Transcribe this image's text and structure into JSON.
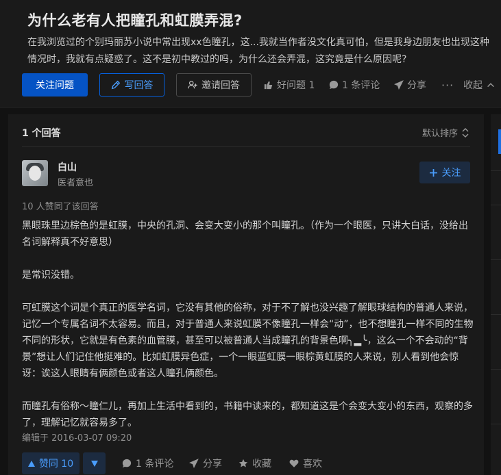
{
  "question": {
    "title": "为什么老有人把瞳孔和虹膜弄混?",
    "description": "在我浏览过的个别玛丽苏小说中常出现xx色瞳孔，这...我就当作者没文化真可怕，但是我身边朋友也出现这种情况时，我就有点疑惑了。这不是初中教过的吗，为什么还会弄混，这究竟是什么原因呢?",
    "follow_label": "关注问题",
    "write_label": "写回答",
    "invite_label": "邀请回答",
    "good_question_label": "好问题 1",
    "comments_label": "1 条评论",
    "share_label": "分享",
    "more_label": "···",
    "collapse_label": "收起"
  },
  "answers": {
    "count_label": "1 个回答",
    "sort_label": "默认排序"
  },
  "answer": {
    "author_name": "白山",
    "author_badge": "医者意也",
    "follow_label": "关注",
    "voters_text": "10 人赞同了该回答",
    "paragraphs": [
      "黑眼珠里边棕色的是虹膜，中央的孔洞、会变大变小的那个叫瞳孔。（作为一个眼医，只讲大白话，没给出名词解释真不好意思）",
      "是常识没错。",
      "可虹膜这个词是个真正的医学名词，它没有其他的俗称，对于不了解也没兴趣了解眼球结构的普通人来说，记忆一个专属名词不太容易。而且，对于普通人来说虹膜不像瞳孔一样会“动”，也不想瞳孔一样不同的生物不同的形状，它就是有色素的血管膜，甚至可以被普通人当成瞳孔的背景色啊╮▂╰，这么一个不会动的“背景”想让人们记住他挺难的。比如虹膜异色症，一个一眼蓝虹膜一眼棕黄虹膜的人来说，别人看到他会惊讶：诶这人眼睛有俩颜色或者这人瞳孔俩颜色。",
      "而瞳孔有俗称～瞳仁儿，再加上生活中看到的，书籍中读来的，都知道这是个会变大变小的东西，观察的多了，理解记忆就容易多了。"
    ],
    "edited_text": "编辑于 2016-03-07 09:20",
    "vote_up_label": "赞同 10",
    "comments_label": "1 条评论",
    "share_label": "分享",
    "collect_label": "收藏",
    "like_label": "喜欢"
  },
  "colors": {
    "primary": "#0553c4",
    "link": "#4a9dfc",
    "background": "#121212",
    "card": "#1a1a1a"
  },
  "icons": [
    "pen-icon",
    "invite-icon",
    "thumbs-up-icon",
    "comment-icon",
    "share-icon",
    "chevron-up-icon",
    "sort-icon",
    "plus-icon",
    "triangle-up-icon",
    "triangle-down-icon",
    "star-icon",
    "heart-icon"
  ]
}
